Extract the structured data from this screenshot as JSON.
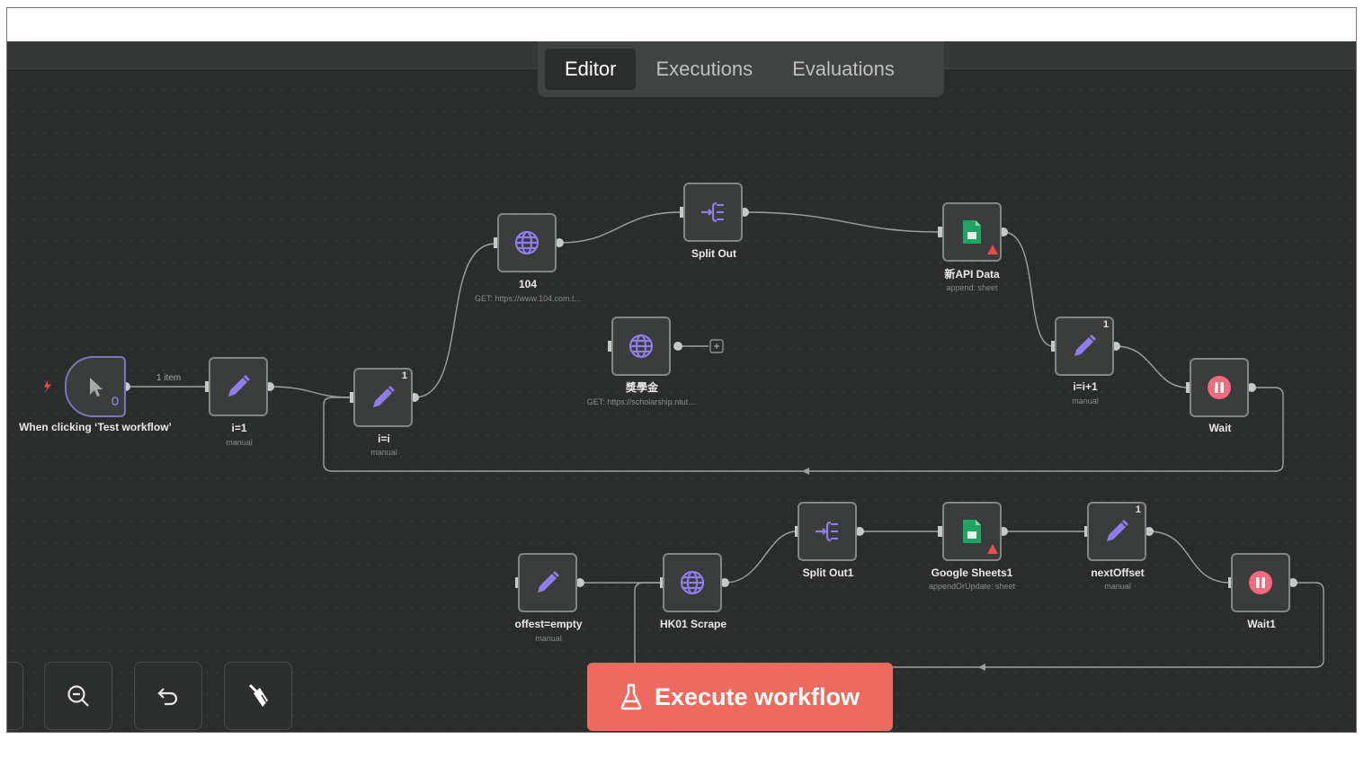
{
  "tabs": [
    {
      "label": "Editor",
      "active": true
    },
    {
      "label": "Executions",
      "active": false
    },
    {
      "label": "Evaluations",
      "active": false
    }
  ],
  "nodes": {
    "trigger": {
      "label": "When clicking ‘Test workflow’",
      "icon": "cursor-icon"
    },
    "i_eq_1": {
      "label": "i=1",
      "sub": "manual",
      "icon": "pencil-icon"
    },
    "i_eq_i": {
      "label": "i=i",
      "sub": "manual",
      "badge": "1",
      "icon": "pencil-icon"
    },
    "n104": {
      "label": "104",
      "sub": "GET: https://www.104.com.t...",
      "icon": "globe-icon"
    },
    "split_out": {
      "label": "Split Out",
      "icon": "split-icon"
    },
    "scholarship": {
      "label": "獎學金",
      "sub": "GET: https://scholarship.ntut....",
      "icon": "globe-icon"
    },
    "new_api_data": {
      "label": "新API Data",
      "sub": "append: sheet",
      "icon": "sheets-icon"
    },
    "i_plus_1": {
      "label": "i=i+1",
      "sub": "manual",
      "badge": "1",
      "icon": "pencil-icon"
    },
    "wait": {
      "label": "Wait",
      "icon": "pause-icon"
    },
    "offest_empty": {
      "label": "offest=empty",
      "sub": "manual",
      "icon": "pencil-icon"
    },
    "hk01_scrape": {
      "label": "HK01 Scrape",
      "icon": "globe-icon"
    },
    "split_out1": {
      "label": "Split Out1",
      "icon": "split-icon"
    },
    "google_sheets1": {
      "label": "Google Sheets1",
      "sub": "appendOrUpdate: sheet",
      "icon": "sheets-icon"
    },
    "next_offset": {
      "label": "nextOffset",
      "sub": "manual",
      "badge": "1",
      "icon": "pencil-icon"
    },
    "wait1": {
      "label": "Wait1",
      "icon": "pause-icon"
    }
  },
  "connection_labels": {
    "trigger_to_i1": "1 item"
  },
  "toolbar": {
    "zoom_out": "zoom-out-icon",
    "undo": "undo-icon",
    "clear": "broom-icon",
    "execute_label": "Execute workflow",
    "execute_icon": "flask-icon"
  },
  "colors": {
    "canvas": "#2b2c2c",
    "node_bg": "#3b3c3c",
    "node_border": "#848686",
    "accent_purple": "#8f7dea",
    "execute_button": "#ec6a5e",
    "wait_icon": "#f16b7f",
    "sheets_icon": "#1fa463",
    "warning": "#e74c4c"
  }
}
